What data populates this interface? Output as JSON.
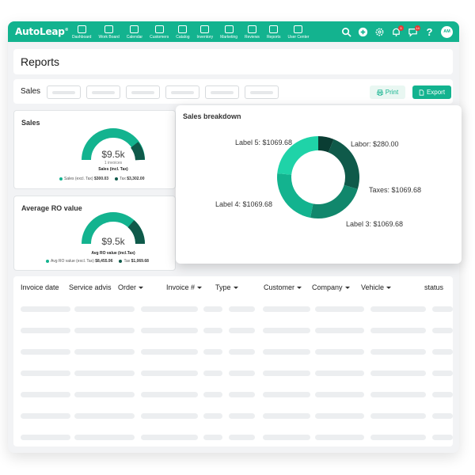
{
  "brand": {
    "name": "AutoLeap",
    "mark": "®"
  },
  "nav": {
    "items": [
      {
        "label": "Dashboard",
        "icon": "dashboard-icon"
      },
      {
        "label": "Work Board",
        "icon": "board-icon"
      },
      {
        "label": "Calendar",
        "icon": "calendar-icon"
      },
      {
        "label": "Customers",
        "icon": "customers-icon"
      },
      {
        "label": "Catalog",
        "icon": "catalog-icon"
      },
      {
        "label": "Inventory",
        "icon": "inventory-icon"
      },
      {
        "label": "Marketing",
        "icon": "megaphone-icon"
      },
      {
        "label": "Reviews",
        "icon": "reviews-icon"
      },
      {
        "label": "Reports",
        "icon": "reports-icon"
      },
      {
        "label": "User Center",
        "icon": "user-center-icon"
      }
    ],
    "avatar_initials": "AM",
    "notification_count": "5",
    "message_count": "14"
  },
  "page": {
    "title": "Reports"
  },
  "filters": {
    "label": "Sales",
    "print_label": "Print",
    "export_label": "Export"
  },
  "sales_card": {
    "title": "Sales",
    "value": "$9.5k",
    "sub": "1 invoices",
    "caption": "Sales (incl. Tax)",
    "legend": [
      {
        "label": "Sales (excl. Tax)",
        "value": "$300.03"
      },
      {
        "label": "Tax",
        "value": "$3,302.00"
      }
    ]
  },
  "avg_card": {
    "title": "Average RO value",
    "value": "$9.5k",
    "caption": "Avg RO value (incl.Tax)",
    "legend": [
      {
        "label": "Avg RO value (excl. Tax)",
        "value": "$8,455.96"
      },
      {
        "label": "Tax",
        "value": "$1,069.68"
      }
    ]
  },
  "breakdown": {
    "title": "Sales breakdown",
    "slices": [
      {
        "label": "Labor: $280.00",
        "value": 280.0,
        "color": "#0a3d33"
      },
      {
        "label": "Taxes: $1069.68",
        "value": 1069.68,
        "color": "#0f5a4a"
      },
      {
        "label": "Label 3: $1069.68",
        "value": 1069.68,
        "color": "#11876c"
      },
      {
        "label": "Label 4: $1069.68",
        "value": 1069.68,
        "color": "#13b38f"
      },
      {
        "label": "Label 5: $1069.68",
        "value": 1069.68,
        "color": "#1fd3a8"
      }
    ]
  },
  "table": {
    "columns": [
      "Invoice date",
      "Service advis",
      "Order",
      "Invoice #",
      "Type",
      "Customer",
      "Company",
      "Vehicle",
      "status"
    ],
    "sortable": [
      false,
      false,
      true,
      true,
      true,
      true,
      true,
      true,
      false
    ]
  },
  "colors": {
    "brand": "#13b38f",
    "dark": "#0a3d33"
  }
}
